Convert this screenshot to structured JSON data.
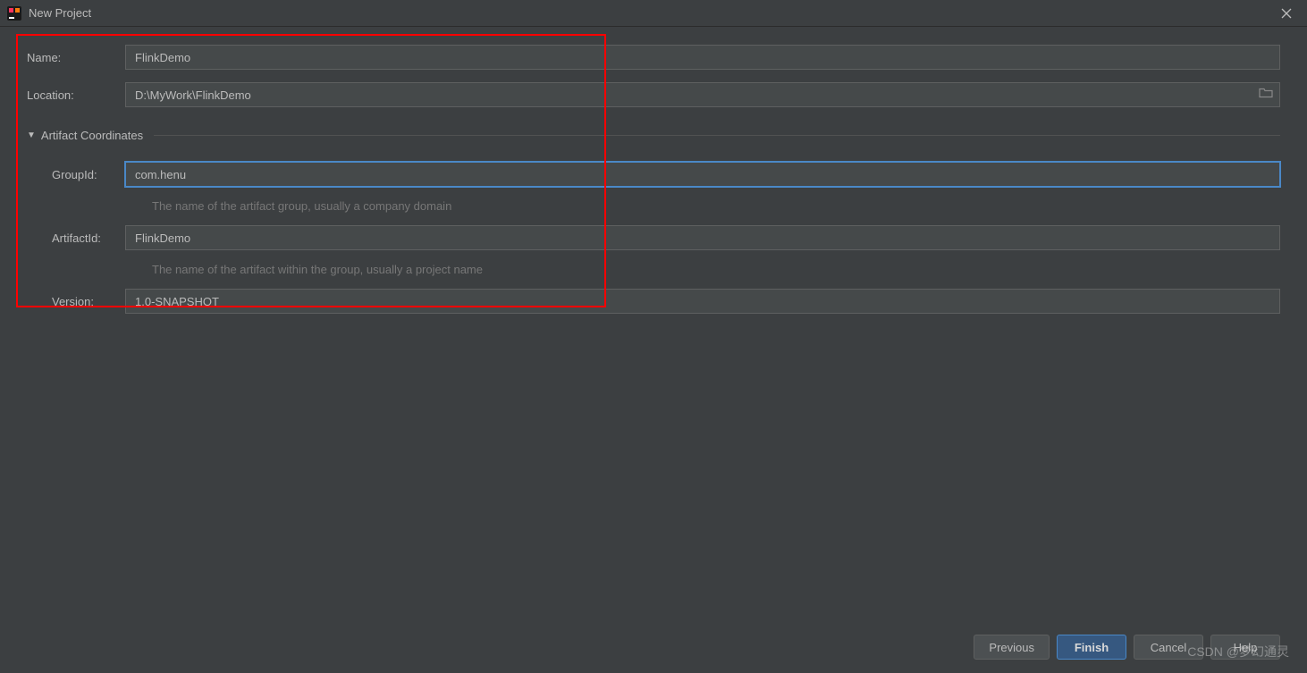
{
  "window": {
    "title": "New Project"
  },
  "form": {
    "name_label": "Name:",
    "name_value": "FlinkDemo",
    "location_label": "Location:",
    "location_value": "D:\\MyWork\\FlinkDemo"
  },
  "section": {
    "title": "Artifact Coordinates"
  },
  "artifact": {
    "groupid_label": "GroupId:",
    "groupid_value": "com.henu",
    "groupid_hint": "The name of the artifact group, usually a company domain",
    "artifactid_label": "ArtifactId:",
    "artifactid_value": "FlinkDemo",
    "artifactid_hint": "The name of the artifact within the group, usually a project name",
    "version_label": "Version:",
    "version_value": "1.0-SNAPSHOT"
  },
  "buttons": {
    "previous": "Previous",
    "finish": "Finish",
    "cancel": "Cancel",
    "help": "Help"
  },
  "watermark": "CSDN @梦幻通灵"
}
